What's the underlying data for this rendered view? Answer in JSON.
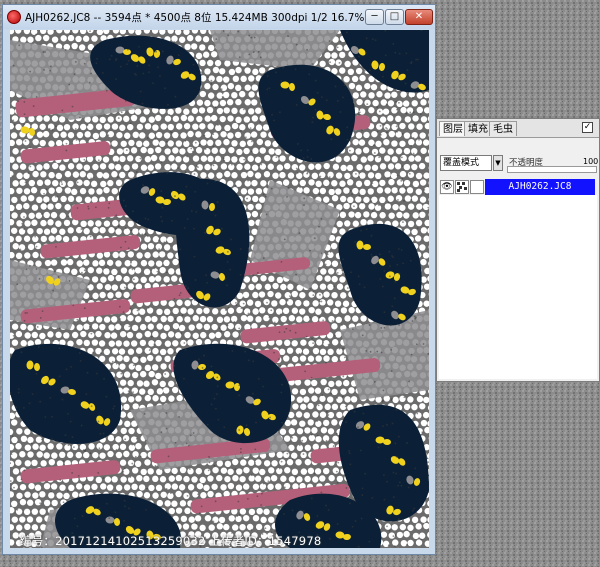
{
  "window": {
    "title": "AJH0262.JC8 -- 3594点 * 4500点 8位 15.424MB 300dpi 1/2  16.7%",
    "minimize_symbol": "─",
    "maximize_symbol": "□",
    "close_symbol": "✕"
  },
  "palette": {
    "tabs": [
      "图层",
      "填充",
      "毛虫"
    ],
    "check_mark": "✓",
    "blend_mode": "覆盖模式",
    "opacity_label": "不透明度",
    "opacity_value": "100",
    "layer_name": "AJH0262.JC8"
  },
  "watermark": "编号：20171214102513259032 上传者ID：1547978",
  "colors": {
    "navy": "#0b2036",
    "rose": "#b5607a",
    "gray": "#8e8e92",
    "yellow": "#f0d21e",
    "white": "#ffffff",
    "selection_blue": "#1212ff"
  }
}
